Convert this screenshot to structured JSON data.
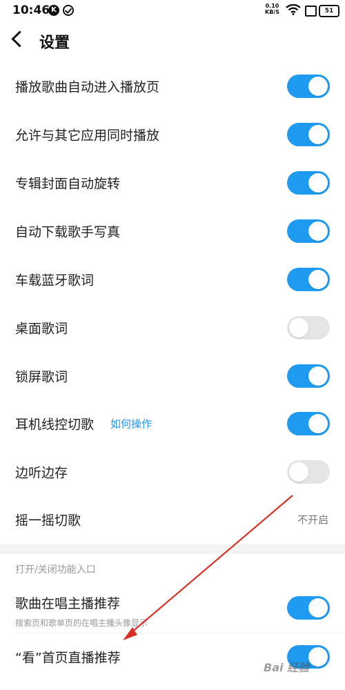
{
  "status_bar": {
    "time": "10:46",
    "k_badge": "K",
    "net_speed_value": "0.10",
    "net_speed_unit": "KB/S",
    "battery": "51"
  },
  "header": {
    "back_icon": "chevron-left-icon",
    "title": "设置"
  },
  "settings": [
    {
      "label": "播放歌曲自动进入播放页",
      "toggle": "on"
    },
    {
      "label": "允许与其它应用同时播放",
      "toggle": "on"
    },
    {
      "label": "专辑封面自动旋转",
      "toggle": "on"
    },
    {
      "label": "自动下载歌手写真",
      "toggle": "on"
    },
    {
      "label": "车载蓝牙歌词",
      "toggle": "on"
    },
    {
      "label": "桌面歌词",
      "toggle": "off"
    },
    {
      "label": "锁屏歌词",
      "toggle": "on"
    },
    {
      "label": "耳机线控切歌",
      "link": "如何操作",
      "toggle": "on"
    },
    {
      "label": "边听边存",
      "toggle": "off"
    },
    {
      "label": "摇一摇切歌",
      "value": "不开启"
    }
  ],
  "section": {
    "header": "打开/关闭功能入口",
    "items": [
      {
        "label": "歌曲在唱主播推荐",
        "sublabel": "搜索页和歌单页的在唱主播头像显示",
        "toggle": "on"
      },
      {
        "label": "“看”首页直播推荐",
        "toggle": "on"
      }
    ]
  },
  "watermark": "Bai 经验",
  "colors": {
    "toggle_on": "#1e9bf0",
    "toggle_off": "#e5e5e5",
    "link": "#2196f3",
    "annotation_arrow": "#d93025"
  }
}
